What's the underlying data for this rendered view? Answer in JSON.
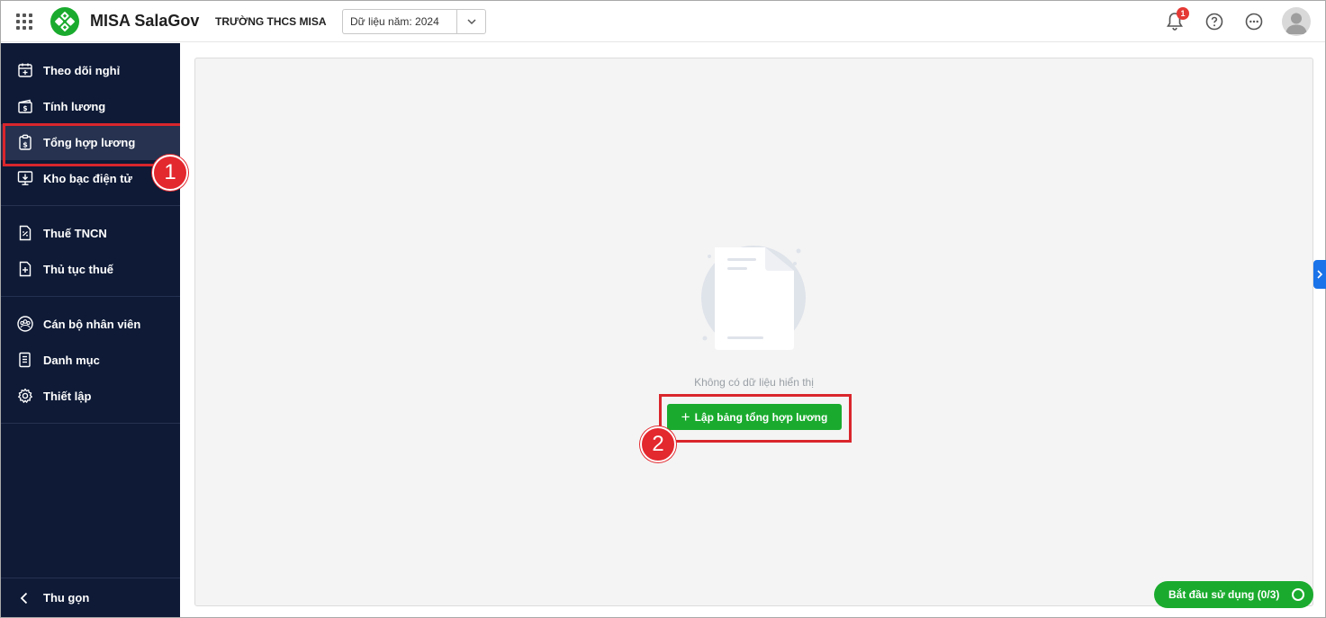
{
  "header": {
    "app_name": "MISA SalaGov",
    "school_name": "TRƯỜNG THCS MISA",
    "year_select": "Dữ liệu năm: 2024",
    "notification_count": "1",
    "icons": [
      "apps-grid-icon",
      "misa-logo",
      "chevron-down-icon",
      "bell-icon",
      "help-icon",
      "more-icon",
      "avatar"
    ]
  },
  "sidebar": {
    "groups": [
      [
        {
          "label": "Theo dõi nghỉ",
          "icon": "calendar-icon"
        },
        {
          "label": "Tính lương",
          "icon": "wallet-icon"
        },
        {
          "label": "Tổng hợp lương",
          "icon": "clipboard-dollar-icon",
          "active": true
        },
        {
          "label": "Kho bạc điện tử",
          "icon": "monitor-download-icon"
        }
      ],
      [
        {
          "label": "Thuế TNCN",
          "icon": "percent-doc-icon"
        },
        {
          "label": "Thủ tục thuế",
          "icon": "doc-plus-icon"
        }
      ],
      [
        {
          "label": "Cán bộ nhân viên",
          "icon": "staff-icon"
        },
        {
          "label": "Danh mục",
          "icon": "list-doc-icon"
        },
        {
          "label": "Thiết lập",
          "icon": "gear-icon"
        }
      ]
    ],
    "collapse_label": "Thu gọn"
  },
  "main": {
    "empty_text": "Không có dữ liệu hiển thị",
    "create_button": "Lập bảng tổng hợp lương",
    "start_button": "Bắt đầu sử dụng (0/3)"
  },
  "annotations": {
    "callout_1": "1",
    "callout_2": "2"
  },
  "colors": {
    "sidebar_bg": "#0e1a36",
    "accent_green": "#1aab2e",
    "highlight_red": "#d9262c",
    "side_tab_blue": "#1a73e8"
  }
}
